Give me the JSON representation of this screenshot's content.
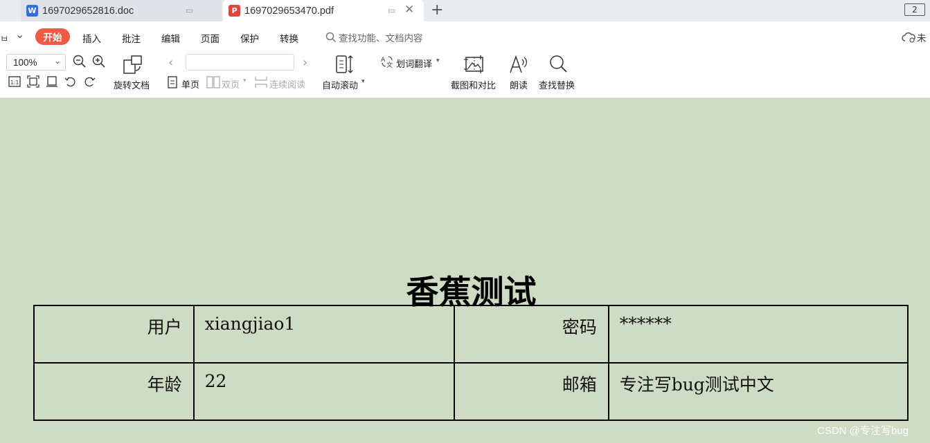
{
  "tabs": [
    {
      "title": "1697029652816.doc",
      "type": "word"
    },
    {
      "title": "1697029653470.pdf",
      "type": "pdf"
    }
  ],
  "icons": {
    "word_doc": "word-icon",
    "pdf_doc": "pdf-icon",
    "close": "close-icon",
    "new_tab": "plus-icon",
    "search": "search-icon",
    "cloud": "cloud-icon"
  },
  "window_badge": "2",
  "menu": {
    "left_glyph": "ㅂ",
    "more": "⌄",
    "start": "开始",
    "items": [
      "插入",
      "批注",
      "编辑",
      "页面",
      "保护",
      "转换"
    ],
    "search_placeholder": "查找功能、文档内容",
    "cloud_label": "未"
  },
  "toolbar": {
    "zoom": "100%",
    "rotate_label": "旋转文档",
    "single_page": "单页",
    "double_page": "双页",
    "continuous": "连续阅读",
    "auto_scroll": "自动滚动",
    "translate": "划词翻译",
    "screenshot_compare": "截图和对比",
    "read_aloud": "朗读",
    "find_replace": "查找替换"
  },
  "document": {
    "title": "香蕉测试",
    "rows": [
      [
        {
          "label": "用户",
          "value": "xiangjiao1"
        },
        {
          "label": "密码",
          "value": "******"
        }
      ],
      [
        {
          "label": "年龄",
          "value": "22"
        },
        {
          "label": "邮箱",
          "value": "专注写bug测试中文"
        }
      ]
    ]
  },
  "watermark": "CSDN @专注写bug",
  "colors": {
    "accent": "#ee5a44",
    "page_background": "#cfdcc4",
    "word_icon": "#2f6fe0",
    "pdf_icon": "#e0463b"
  }
}
